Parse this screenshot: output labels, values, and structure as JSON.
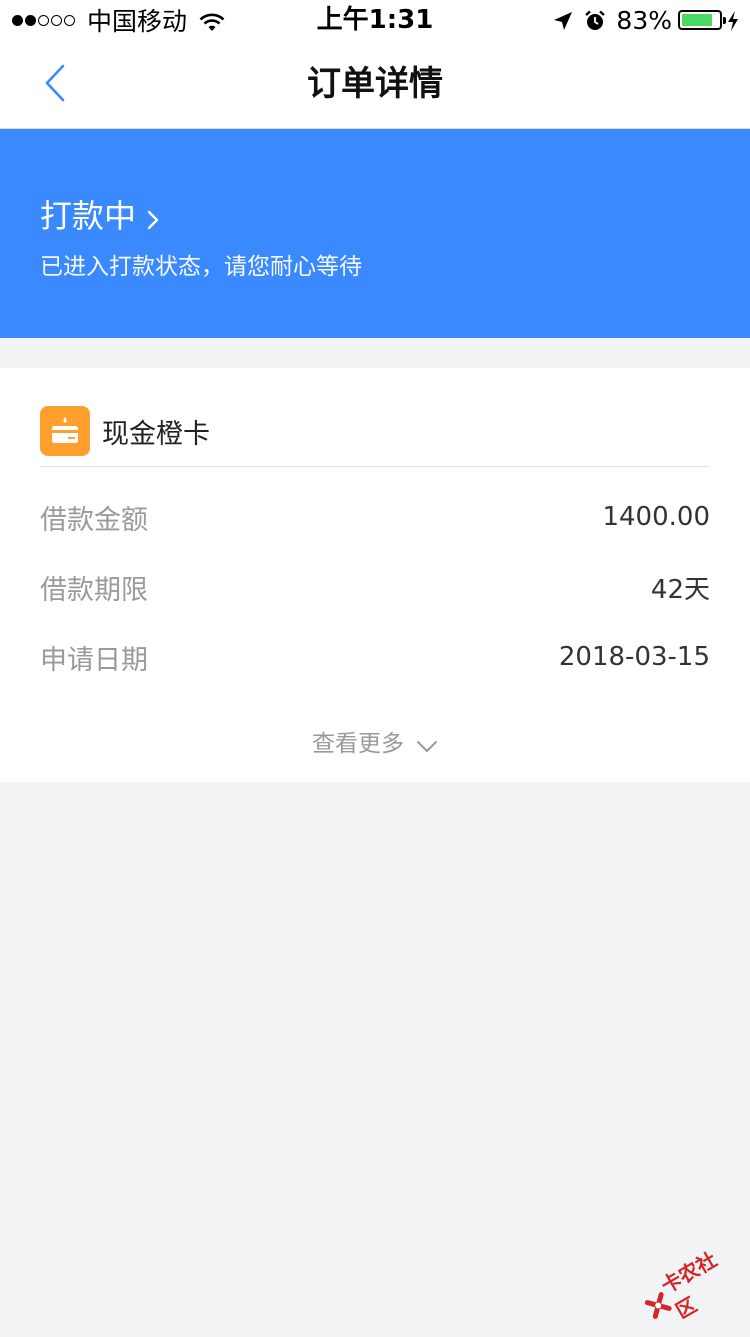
{
  "status_bar": {
    "carrier": "中国移动",
    "time": "上午1:31",
    "battery_percent": "83%",
    "battery_level": 0.83,
    "signal_bars_filled": 2,
    "signal_bars_total": 5
  },
  "nav": {
    "title": "订单详情",
    "back_icon": "chevron-left-icon"
  },
  "banner": {
    "status": "打款中",
    "description": "已进入打款状态，请您耐心等待",
    "background_color": "#3b89ff"
  },
  "card": {
    "product_name": "现金橙卡",
    "product_logo_color": "#ff9f2e",
    "rows": [
      {
        "label": "借款金额",
        "value": "1400.00"
      },
      {
        "label": "借款期限",
        "value": "42天"
      },
      {
        "label": "申请日期",
        "value": "2018-03-15"
      }
    ],
    "view_more": "查看更多"
  },
  "watermark": {
    "text": "卡农社区"
  }
}
